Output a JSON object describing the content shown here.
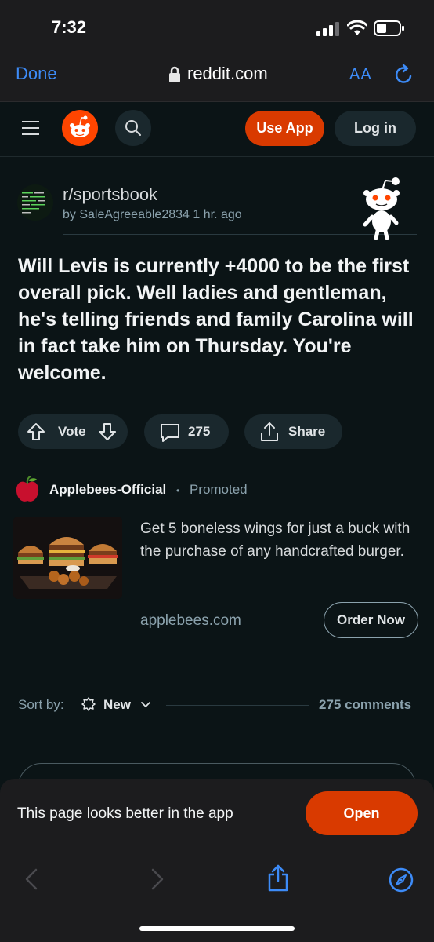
{
  "status_bar": {
    "time": "7:32"
  },
  "safari": {
    "done_label": "Done",
    "url": "reddit.com",
    "text_size_label": "AA"
  },
  "header": {
    "use_app_label": "Use App",
    "login_label": "Log in",
    "brand_color": "#d93a00"
  },
  "post": {
    "subreddit": "r/sportsbook",
    "author_prefix": "by",
    "author": "SaleAgreeable2834",
    "age": "1 hr. ago",
    "title": "Will Levis is currently +4000 to be the first overall pick. Well ladies and gentleman, he's telling friends and family Carolina will in fact take him on Thursday. You're welcome.",
    "vote_label": "Vote",
    "comments_count": "275",
    "share_label": "Share"
  },
  "ad": {
    "advertiser": "Applebees-Official",
    "separator": "•",
    "promoted_label": "Promoted",
    "text": "Get 5 boneless wings for just a buck with the purchase of any handcrafted burger.",
    "domain": "applebees.com",
    "cta_label": "Order Now"
  },
  "comments_bar": {
    "sort_prefix": "Sort by:",
    "sort_value": "New",
    "count_label": "275 comments"
  },
  "app_banner": {
    "message": "This page looks better in the app",
    "open_label": "Open"
  }
}
